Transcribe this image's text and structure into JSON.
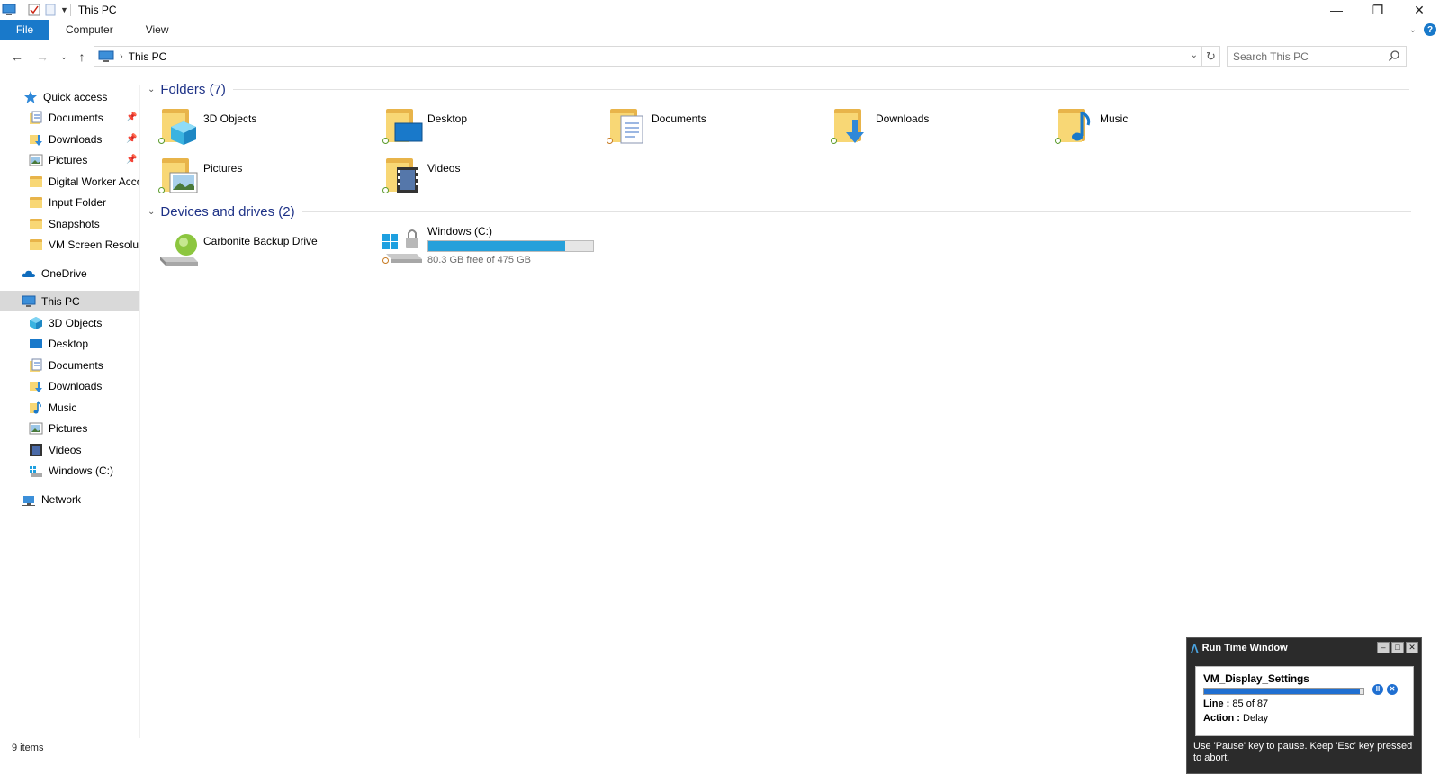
{
  "window": {
    "title": "This PC"
  },
  "ribbon": {
    "tabs": [
      "File",
      "Computer",
      "View"
    ],
    "help": "?"
  },
  "address": {
    "breadcrumb": "This PC",
    "search_placeholder": "Search This PC"
  },
  "sidebar": {
    "quick_access": "Quick access",
    "quick_items": [
      "Documents",
      "Downloads",
      "Pictures",
      "Digital Worker Acco",
      "Input Folder",
      "Snapshots",
      "VM Screen Resolutio"
    ],
    "onedrive": "OneDrive",
    "this_pc": "This PC",
    "pc_items": [
      "3D Objects",
      "Desktop",
      "Documents",
      "Downloads",
      "Music",
      "Pictures",
      "Videos",
      "Windows (C:)"
    ],
    "network": "Network"
  },
  "content": {
    "folders_header": "Folders (7)",
    "folders": [
      "3D Objects",
      "Desktop",
      "Documents",
      "Downloads",
      "Music",
      "Pictures",
      "Videos"
    ],
    "drives_header": "Devices and drives (2)",
    "drives": [
      {
        "name": "Carbonite Backup Drive"
      },
      {
        "name": "Windows (C:)",
        "free_text": "80.3 GB free of 475 GB",
        "used_fraction": 0.83
      }
    ]
  },
  "status": {
    "items": "9 items"
  },
  "runtime": {
    "title": "Run Time Window",
    "task": "VM_Display_Settings",
    "progress_fraction": 0.98,
    "line_label": "Line :",
    "line_value": "85 of 87",
    "action_label": "Action :",
    "action_value": "Delay",
    "footer": "Use 'Pause' key to pause. Keep 'Esc' key pressed to abort."
  },
  "colors": {
    "accent": "#1979ca",
    "header": "#1e3287",
    "drive_bar": "#26a0da",
    "folder": "#f8d775"
  }
}
